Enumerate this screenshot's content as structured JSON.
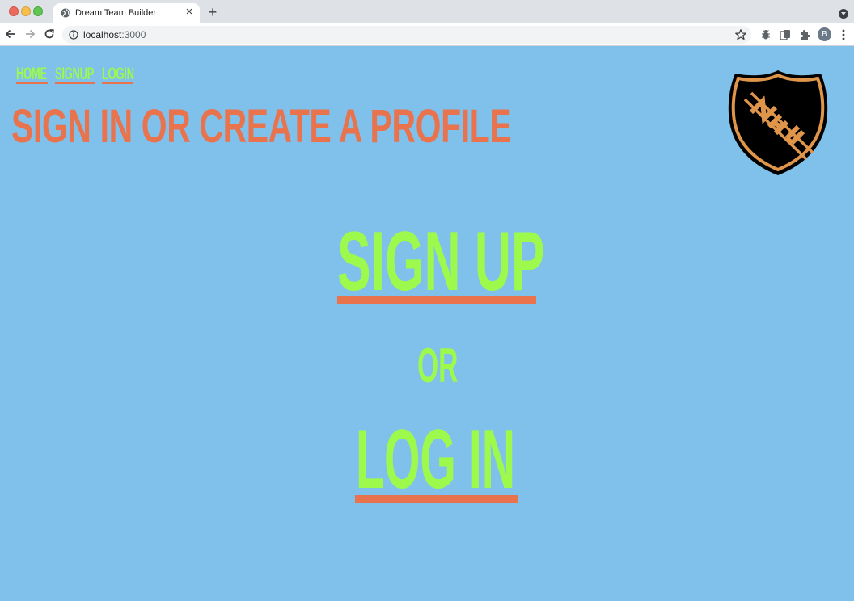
{
  "browser": {
    "tab_title": "Dream Team Builder",
    "tab_close": "×",
    "new_tab": "+",
    "url_host": "localhost",
    "url_port": ":3000",
    "profile_initial": "B"
  },
  "nav": {
    "home": "HOME",
    "signup": "SIGNUP",
    "login": "LOGIN"
  },
  "page": {
    "title": "SIGN IN OR CREATE A PROFILE",
    "signup_link": "SIGN UP",
    "or": "OR",
    "login_link": "LOG IN"
  },
  "logo": {
    "text": "NHL",
    "name": "nhl-shield-logo"
  },
  "colors": {
    "background": "#80c1ec",
    "accent_green": "#9dfa4c",
    "accent_orange": "#e8734c",
    "logo_gold": "#e0964a",
    "logo_black": "#000000"
  }
}
